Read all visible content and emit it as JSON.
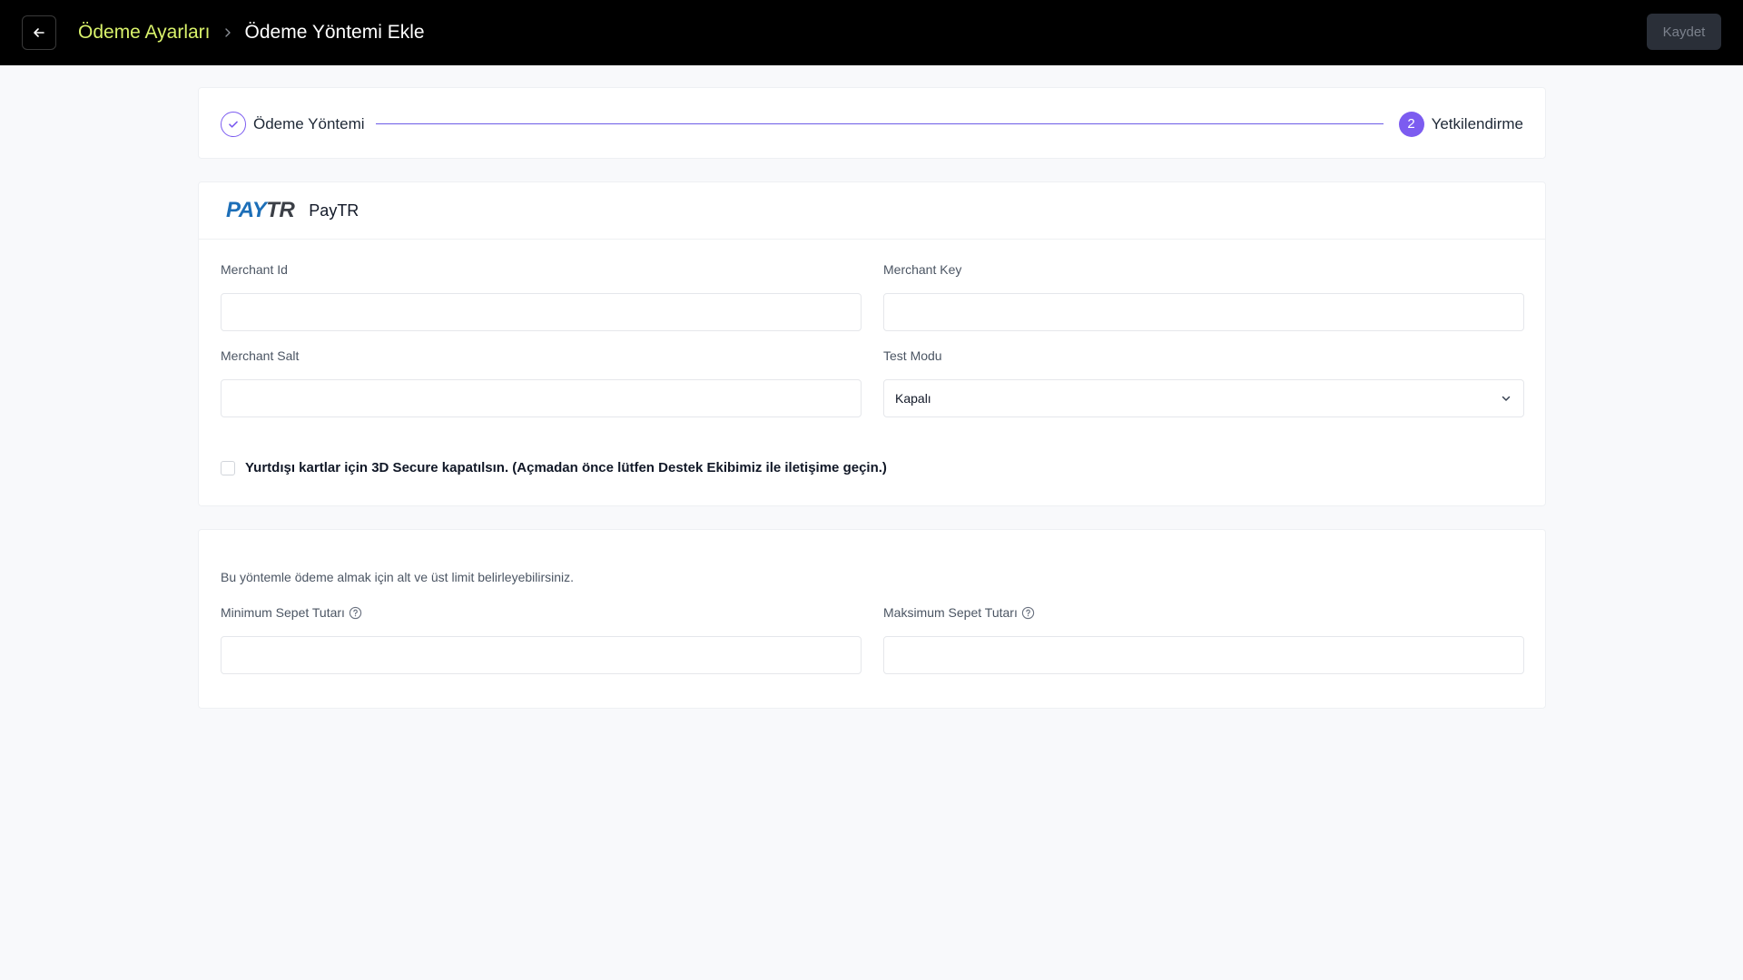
{
  "header": {
    "breadcrumb_parent": "Ödeme Ayarları",
    "breadcrumb_current": "Ödeme Yöntemi Ekle",
    "save_label": "Kaydet"
  },
  "stepper": {
    "steps": [
      {
        "label": "Ödeme Yöntemi",
        "state": "completed"
      },
      {
        "number": "2",
        "label": "Yetkilendirme",
        "state": "active"
      }
    ],
    "accent_color": "#7c5cf0"
  },
  "provider": {
    "logo_part1": "PAY",
    "logo_part2": "TR",
    "name": "PayTR"
  },
  "form": {
    "merchant_id": {
      "label": "Merchant Id",
      "value": ""
    },
    "merchant_key": {
      "label": "Merchant Key",
      "value": ""
    },
    "merchant_salt": {
      "label": "Merchant Salt",
      "value": ""
    },
    "test_mode": {
      "label": "Test Modu",
      "selected": "Kapalı"
    },
    "secure_checkbox": {
      "label": "Yurtdışı kartlar için 3D Secure kapatılsın. (Açmadan önce lütfen Destek Ekibimiz ile iletişime geçin.)",
      "checked": false
    }
  },
  "limits": {
    "description": "Bu yöntemle ödeme almak için alt ve üst limit belirleyebilirsiniz.",
    "min_label": "Minimum Sepet Tutarı",
    "min_value": "",
    "max_label": "Maksimum Sepet Tutarı",
    "max_value": ""
  },
  "icons": {
    "back": "arrow-left-icon",
    "separator": "chevron-right-icon",
    "check": "check-icon",
    "dropdown": "chevron-down-icon",
    "help": "question-circle-icon"
  }
}
